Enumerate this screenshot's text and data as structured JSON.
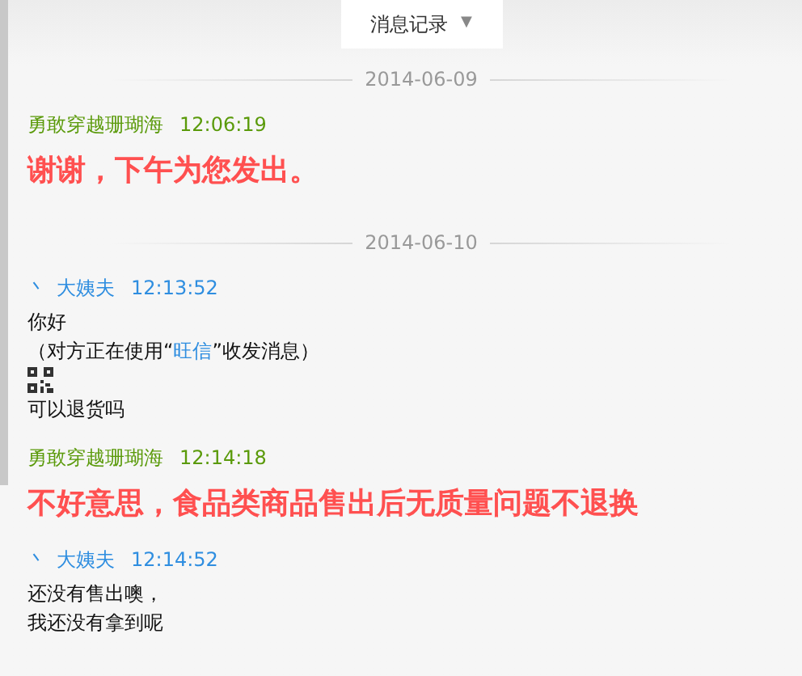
{
  "header": {
    "title": "消息记录",
    "caret": "▼"
  },
  "days": [
    {
      "date": "2014-06-09",
      "messages": [
        {
          "kind": "seller",
          "sender": "勇敢穿越珊瑚海",
          "time": "12:06:19",
          "lines": [
            {
              "kind": "emphasis",
              "text": "谢谢，下午为您发出。"
            }
          ]
        }
      ]
    },
    {
      "date": "2014-06-10",
      "messages": [
        {
          "kind": "buyer",
          "marker": "丶",
          "sender": "大姨夫",
          "time": "12:13:52",
          "lines": [
            {
              "kind": "text",
              "text": "你好"
            },
            {
              "kind": "segments",
              "parts": [
                {
                  "text": "（对方正在使用“",
                  "link": false
                },
                {
                  "text": "旺信",
                  "link": true
                },
                {
                  "text": "”收发消息）",
                  "link": false
                }
              ]
            },
            {
              "kind": "qr"
            },
            {
              "kind": "text",
              "text": "可以退货吗"
            }
          ]
        },
        {
          "kind": "seller",
          "sender": "勇敢穿越珊瑚海",
          "time": "12:14:18",
          "lines": [
            {
              "kind": "emphasis",
              "text": "不好意思，食品类商品售出后无质量问题不退换"
            }
          ]
        },
        {
          "kind": "buyer",
          "marker": "丶",
          "sender": "大姨夫",
          "time": "12:14:52",
          "lines": [
            {
              "kind": "text",
              "text": "还没有售出噢，"
            },
            {
              "kind": "text",
              "text": "我还没有拿到呢"
            }
          ]
        }
      ]
    }
  ]
}
